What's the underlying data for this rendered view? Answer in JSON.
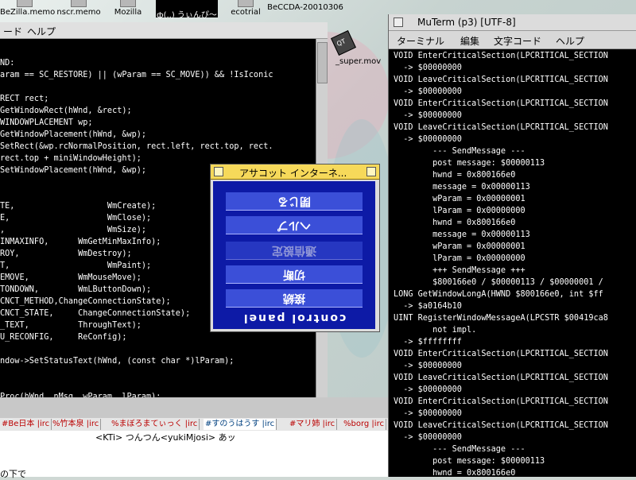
{
  "desktop": {
    "icons": [
      "BeZilla.memo",
      "nscr.memo",
      "Mozilla",
      "ф(..) うぃんぴ～",
      "ecotrial",
      "BeCCDA-20010306"
    ],
    "qt_file": "_super.mov"
  },
  "editor": {
    "menu": [
      "ード",
      "ヘルプ"
    ],
    "code_lines": [
      "ND:",
      "aram == SC_RESTORE) || (wParam == SC_MOVE)) && !IsIconic",
      "",
      "RECT rect;",
      "GetWindowRect(hWnd, &rect);",
      "WINDOWPLACEMENT wp;",
      "GetWindowPlacement(hWnd, &wp);",
      "SetRect(&wp.rcNormalPosition, rect.left, rect.top, rect.",
      "rect.top + miniWindowHeight);",
      "SetWindowPlacement(hWnd, &wp);",
      "",
      "",
      "TE,                   WmCreate);",
      "E,                    WmClose);",
      ",                     WmSize);",
      "INMAXINFO,      WmGetMinMaxInfo);",
      "ROY,            WmDestroy);",
      "T,                    WmPaint);",
      "EMOVE,          WmMouseMove);",
      "TONDOWN,        WmLButtonDown);",
      "CNCT_METHOD,ChangeConnectionState);",
      "CNCT_STATE,     ChangeConnectionState);",
      "_TEXT,          ThroughText);",
      "U_RECONFIG,     ReConfig);",
      "",
      "ndow->SetStatusText(hWnd, (const char *)lParam);",
      "",
      "",
      "Proc(hWnd, nMsg, wParam, lParam);"
    ]
  },
  "irc": {
    "tabs": [
      "#Be日本 |irc",
      "%竹本泉 |irc",
      "%まぼろまてぃっく |irc",
      "#すのうはうす |irc",
      "#マリ姉 |irc",
      "%borg |irc"
    ],
    "active_tab_index": 3,
    "message": "<KTi> つんつん<yukiMjosi> あッ",
    "bottom_text": "の下で"
  },
  "ascot": {
    "title": "アサコット インターネ...",
    "buttons": [
      "接続",
      "切断",
      "通信設定",
      "ヘルプ",
      "閉じる"
    ],
    "bottom_label": "control panel"
  },
  "muterm": {
    "title": "MuTerm (p3) [UTF-8]",
    "menu": [
      "ターミナル",
      "編集",
      "文字コード",
      "ヘルプ"
    ],
    "lines": [
      "VOID EnterCriticalSection(LPCRITICAL_SECTION",
      "  -> $00000000",
      "VOID LeaveCriticalSection(LPCRITICAL_SECTION",
      "  -> $00000000",
      "VOID EnterCriticalSection(LPCRITICAL_SECTION",
      "  -> $00000000",
      "VOID LeaveCriticalSection(LPCRITICAL_SECTION",
      "  -> $00000000",
      "        --- SendMessage ---",
      "        post message: $00000113",
      "        hwnd = 0x800166e0",
      "        message = 0x00000113",
      "        wParam = 0x00000001",
      "        lParam = 0x00000000",
      "        hwnd = 0x800166e0",
      "        message = 0x00000113",
      "        wParam = 0x00000001",
      "        lParam = 0x00000000",
      "        +++ SendMessage +++",
      "        $800166e0 / $00000113 / $00000001 /",
      "LONG GetWindowLongA(HWND $800166e0, int $ff",
      "  -> $a0164b10",
      "UINT RegisterWindowMessageA(LPCSTR $00419ca8",
      "        not impl.",
      "  -> $ffffffff",
      "VOID EnterCriticalSection(LPCRITICAL_SECTION",
      "  -> $00000000",
      "VOID LeaveCriticalSection(LPCRITICAL_SECTION",
      "  -> $00000000",
      "VOID EnterCriticalSection(LPCRITICAL_SECTION",
      "  -> $00000000",
      "VOID LeaveCriticalSection(LPCRITICAL_SECTION",
      "  -> $00000000",
      "        --- SendMessage ---",
      "        post message: $00000113",
      "        hwnd = 0x800166e0"
    ]
  }
}
